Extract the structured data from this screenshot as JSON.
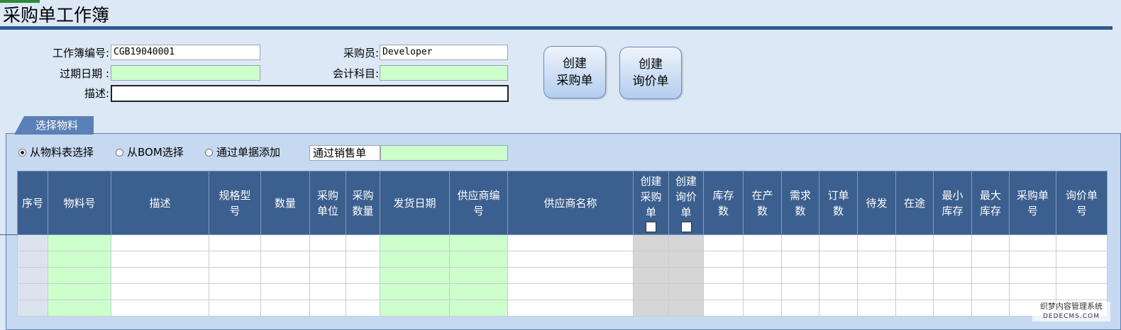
{
  "window": {
    "title": "采购单工作簿"
  },
  "form": {
    "workbook_no_label": "工作簿编号:",
    "workbook_no_value": "CGB19040001",
    "buyer_label": "采购员:",
    "buyer_value": "Developer",
    "expire_label": "过期日期 :",
    "expire_value": "",
    "account_label": "会计科目:",
    "account_value": "",
    "desc_label": "描述:",
    "desc_value": ""
  },
  "buttons": {
    "create_po": [
      "创建",
      "采购单"
    ],
    "create_rfq": [
      "创建",
      "询价单"
    ]
  },
  "tab": {
    "label": "选择物料"
  },
  "source": {
    "options": [
      "从物料表选择",
      "从BOM选择",
      "通过单据添加"
    ],
    "selected": 0,
    "sales_order_label": "通过销售单",
    "sales_order_value": ""
  },
  "table": {
    "columns": [
      {
        "label": [
          "序号"
        ],
        "w": 43,
        "type": "seq"
      },
      {
        "label": [
          "物料号"
        ],
        "w": 89,
        "type": "green"
      },
      {
        "label": [
          "描述"
        ],
        "w": 138,
        "type": ""
      },
      {
        "label": [
          "规格型",
          "号"
        ],
        "w": 73,
        "type": ""
      },
      {
        "label": [
          "数量"
        ],
        "w": 69,
        "type": ""
      },
      {
        "label": [
          "采购",
          "单位"
        ],
        "w": 51,
        "type": ""
      },
      {
        "label": [
          "采购",
          "数量"
        ],
        "w": 48,
        "type": ""
      },
      {
        "label": [
          "发货日期"
        ],
        "w": 98,
        "type": "green"
      },
      {
        "label": [
          "供应商编",
          "号"
        ],
        "w": 82,
        "type": "green"
      },
      {
        "label": [
          "供应商名称"
        ],
        "w": 177,
        "type": ""
      },
      {
        "label": [
          "创建",
          "采购",
          "单"
        ],
        "w": 50,
        "type": "gray",
        "checkbox": true
      },
      {
        "label": [
          "创建",
          "询价",
          "单"
        ],
        "w": 49,
        "type": "gray",
        "checkbox": true
      },
      {
        "label": [
          "库存",
          "数"
        ],
        "w": 56,
        "type": ""
      },
      {
        "label": [
          "在产",
          "数"
        ],
        "w": 54,
        "type": ""
      },
      {
        "label": [
          "需求",
          "数"
        ],
        "w": 53,
        "type": ""
      },
      {
        "label": [
          "订单",
          "数"
        ],
        "w": 54,
        "type": ""
      },
      {
        "label": [
          "待发"
        ],
        "w": 54,
        "type": ""
      },
      {
        "label": [
          "在途"
        ],
        "w": 53,
        "type": ""
      },
      {
        "label": [
          "最小",
          "库存"
        ],
        "w": 54,
        "type": ""
      },
      {
        "label": [
          "最大",
          "库存"
        ],
        "w": 53,
        "type": ""
      },
      {
        "label": [
          "采购单",
          "号"
        ],
        "w": 66,
        "type": ""
      },
      {
        "label": [
          "询价单",
          "号"
        ],
        "w": 72,
        "type": ""
      }
    ],
    "rows": 5
  },
  "watermark": {
    "line1": "织梦内容管理系统",
    "line2": "DEDECMS.COM"
  }
}
